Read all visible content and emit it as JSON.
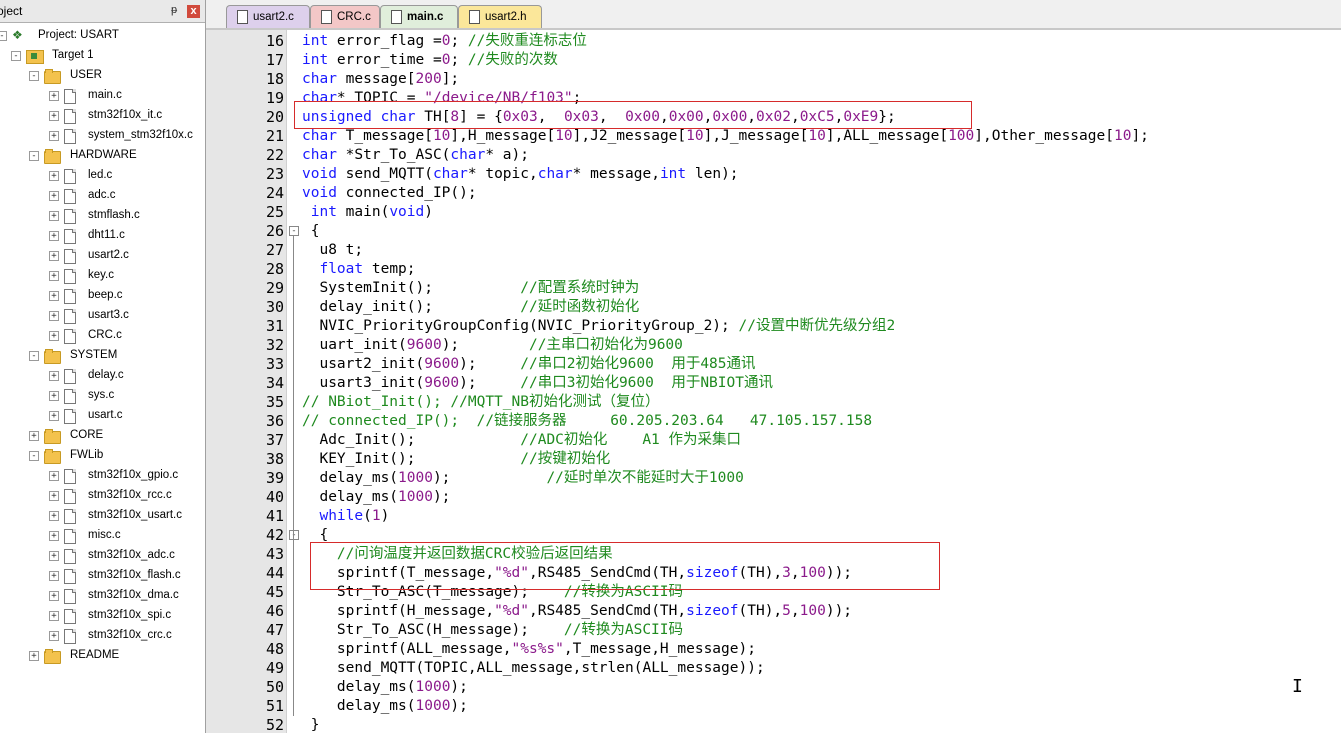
{
  "panel": {
    "title": "oject",
    "pin": "ᵽ",
    "close": "x"
  },
  "tree": [
    {
      "label": "Project: USART",
      "type": "project",
      "depth": 0,
      "expander": "-"
    },
    {
      "label": "Target 1",
      "type": "target",
      "depth": 1,
      "expander": "-"
    },
    {
      "label": "USER",
      "type": "folder",
      "depth": 2,
      "expander": "-"
    },
    {
      "label": "main.c",
      "type": "file",
      "depth": 3,
      "expander": "+"
    },
    {
      "label": "stm32f10x_it.c",
      "type": "file",
      "depth": 3,
      "expander": "+"
    },
    {
      "label": "system_stm32f10x.c",
      "type": "file",
      "depth": 3,
      "expander": "+"
    },
    {
      "label": "HARDWARE",
      "type": "folder",
      "depth": 2,
      "expander": "-"
    },
    {
      "label": "led.c",
      "type": "file",
      "depth": 3,
      "expander": "+"
    },
    {
      "label": "adc.c",
      "type": "file",
      "depth": 3,
      "expander": "+"
    },
    {
      "label": "stmflash.c",
      "type": "file",
      "depth": 3,
      "expander": "+"
    },
    {
      "label": "dht11.c",
      "type": "file",
      "depth": 3,
      "expander": "+"
    },
    {
      "label": "usart2.c",
      "type": "file",
      "depth": 3,
      "expander": "+"
    },
    {
      "label": "key.c",
      "type": "file",
      "depth": 3,
      "expander": "+"
    },
    {
      "label": "beep.c",
      "type": "file",
      "depth": 3,
      "expander": "+"
    },
    {
      "label": "usart3.c",
      "type": "file",
      "depth": 3,
      "expander": "+"
    },
    {
      "label": "CRC.c",
      "type": "file",
      "depth": 3,
      "expander": "+"
    },
    {
      "label": "SYSTEM",
      "type": "folder",
      "depth": 2,
      "expander": "-"
    },
    {
      "label": "delay.c",
      "type": "file",
      "depth": 3,
      "expander": "+"
    },
    {
      "label": "sys.c",
      "type": "file",
      "depth": 3,
      "expander": "+"
    },
    {
      "label": "usart.c",
      "type": "file",
      "depth": 3,
      "expander": "+"
    },
    {
      "label": "CORE",
      "type": "folder",
      "depth": 2,
      "expander": "+"
    },
    {
      "label": "FWLib",
      "type": "folder",
      "depth": 2,
      "expander": "-"
    },
    {
      "label": "stm32f10x_gpio.c",
      "type": "file",
      "depth": 3,
      "expander": "+"
    },
    {
      "label": "stm32f10x_rcc.c",
      "type": "file",
      "depth": 3,
      "expander": "+"
    },
    {
      "label": "stm32f10x_usart.c",
      "type": "file",
      "depth": 3,
      "expander": "+"
    },
    {
      "label": "misc.c",
      "type": "file",
      "depth": 3,
      "expander": "+"
    },
    {
      "label": "stm32f10x_adc.c",
      "type": "file",
      "depth": 3,
      "expander": "+"
    },
    {
      "label": "stm32f10x_flash.c",
      "type": "file",
      "depth": 3,
      "expander": "+"
    },
    {
      "label": "stm32f10x_dma.c",
      "type": "file",
      "depth": 3,
      "expander": "+"
    },
    {
      "label": "stm32f10x_spi.c",
      "type": "file",
      "depth": 3,
      "expander": "+"
    },
    {
      "label": "stm32f10x_crc.c",
      "type": "file",
      "depth": 3,
      "expander": "+"
    },
    {
      "label": "README",
      "type": "folder",
      "depth": 2,
      "expander": "+"
    }
  ],
  "tabs": [
    {
      "label": "usart2.c",
      "active": false
    },
    {
      "label": "CRC.c",
      "active": false
    },
    {
      "label": "main.c",
      "active": true
    },
    {
      "label": "usart2.h",
      "active": false
    }
  ],
  "colors": {
    "keyword": "#1a1aff",
    "number": "#8b1a8b",
    "comment": "#1f8a1f",
    "highlight_box": "#d62b2b"
  },
  "code": [
    {
      "n": 16,
      "t": [
        [
          "kw",
          "int"
        ],
        [
          "",
          " error_flag ="
        ],
        [
          "num",
          "0"
        ],
        [
          "",
          ";"
        ],
        [
          "cm",
          " //失败重连标志位"
        ]
      ]
    },
    {
      "n": 17,
      "t": [
        [
          "kw",
          "int"
        ],
        [
          "",
          " error_time ="
        ],
        [
          "num",
          "0"
        ],
        [
          "",
          ";"
        ],
        [
          "cm",
          " //失败的次数"
        ]
      ]
    },
    {
      "n": 18,
      "t": [
        [
          "kw",
          "char"
        ],
        [
          "",
          " message["
        ],
        [
          "num",
          "200"
        ],
        [
          "",
          "];"
        ]
      ]
    },
    {
      "n": 19,
      "t": [
        [
          "kw",
          "char"
        ],
        [
          "",
          "* TOPIC = "
        ],
        [
          "str",
          "\"/device/NB/f103\""
        ],
        [
          "",
          ";"
        ]
      ]
    },
    {
      "n": 20,
      "t": [
        [
          "kw",
          "unsigned char"
        ],
        [
          "",
          " TH["
        ],
        [
          "num",
          "8"
        ],
        [
          "",
          "] = {"
        ],
        [
          "num",
          "0x03"
        ],
        [
          "",
          ",  "
        ],
        [
          "num",
          "0x03"
        ],
        [
          "",
          ",  "
        ],
        [
          "num",
          "0x00"
        ],
        [
          "",
          ","
        ],
        [
          "num",
          "0x00"
        ],
        [
          "",
          ","
        ],
        [
          "num",
          "0x00"
        ],
        [
          "",
          ","
        ],
        [
          "num",
          "0x02"
        ],
        [
          "",
          ","
        ],
        [
          "num",
          "0xC5"
        ],
        [
          "",
          ","
        ],
        [
          "num",
          "0xE9"
        ],
        [
          "",
          "};"
        ]
      ]
    },
    {
      "n": 21,
      "t": [
        [
          "kw",
          "char"
        ],
        [
          "",
          " T_message["
        ],
        [
          "num",
          "10"
        ],
        [
          "",
          "],H_message["
        ],
        [
          "num",
          "10"
        ],
        [
          "",
          "],J2_message["
        ],
        [
          "num",
          "10"
        ],
        [
          "",
          "],J_message["
        ],
        [
          "num",
          "10"
        ],
        [
          "",
          "],ALL_message["
        ],
        [
          "num",
          "100"
        ],
        [
          "",
          "],Other_message["
        ],
        [
          "num",
          "10"
        ],
        [
          "",
          "];"
        ]
      ]
    },
    {
      "n": 22,
      "t": [
        [
          "kw",
          "char"
        ],
        [
          "",
          " *Str_To_ASC("
        ],
        [
          "kw",
          "char"
        ],
        [
          "",
          "* a);"
        ]
      ]
    },
    {
      "n": 23,
      "t": [
        [
          "kw",
          "void"
        ],
        [
          "",
          " send_MQTT("
        ],
        [
          "kw",
          "char"
        ],
        [
          "",
          "* topic,"
        ],
        [
          "kw",
          "char"
        ],
        [
          "",
          "* message,"
        ],
        [
          "kw",
          "int"
        ],
        [
          "",
          " len);"
        ]
      ]
    },
    {
      "n": 24,
      "t": [
        [
          "kw",
          "void"
        ],
        [
          "",
          " connected_IP();"
        ]
      ]
    },
    {
      "n": 25,
      "t": [
        [
          "",
          " "
        ],
        [
          "kw",
          "int"
        ],
        [
          "",
          " main("
        ],
        [
          "kw",
          "void"
        ],
        [
          "",
          ")"
        ]
      ]
    },
    {
      "n": 26,
      "t": [
        [
          "",
          " {"
        ]
      ],
      "fold": "-"
    },
    {
      "n": 27,
      "t": [
        [
          "",
          "  u8 t;"
        ]
      ]
    },
    {
      "n": 28,
      "t": [
        [
          "",
          "  "
        ],
        [
          "kw",
          "float"
        ],
        [
          "",
          " temp;"
        ]
      ]
    },
    {
      "n": 29,
      "t": [
        [
          "",
          "  SystemInit();          "
        ],
        [
          "cm",
          "//配置系统时钟为"
        ]
      ]
    },
    {
      "n": 30,
      "t": [
        [
          "",
          "  delay_init();          "
        ],
        [
          "cm",
          "//延时函数初始化"
        ]
      ]
    },
    {
      "n": 31,
      "t": [
        [
          "",
          "  NVIC_PriorityGroupConfig(NVIC_PriorityGroup_2); "
        ],
        [
          "cm",
          "//设置中断优先级分组2"
        ]
      ]
    },
    {
      "n": 32,
      "t": [
        [
          "",
          "  uart_init("
        ],
        [
          "num",
          "9600"
        ],
        [
          "",
          ");        "
        ],
        [
          "cm",
          "//主串口初始化为9600"
        ]
      ]
    },
    {
      "n": 33,
      "t": [
        [
          "",
          "  usart2_init("
        ],
        [
          "num",
          "9600"
        ],
        [
          "",
          ");     "
        ],
        [
          "cm",
          "//串口2初始化9600  用于485通讯"
        ]
      ]
    },
    {
      "n": 34,
      "t": [
        [
          "",
          "  usart3_init("
        ],
        [
          "num",
          "9600"
        ],
        [
          "",
          ");     "
        ],
        [
          "cm",
          "//串口3初始化9600  用于NBIOT通讯"
        ]
      ]
    },
    {
      "n": 35,
      "t": [
        [
          "cm",
          "// NBiot_Init(); //MQTT_NB初始化测试（复位）"
        ]
      ]
    },
    {
      "n": 36,
      "t": [
        [
          "cm",
          "// connected_IP();  //链接服务器     60.205.203.64   47.105.157.158"
        ]
      ]
    },
    {
      "n": 37,
      "t": [
        [
          "",
          "  Adc_Init();            "
        ],
        [
          "cm",
          "//ADC初始化    A1 作为采集口"
        ]
      ]
    },
    {
      "n": 38,
      "t": [
        [
          "",
          "  KEY_Init();            "
        ],
        [
          "cm",
          "//按键初始化"
        ]
      ]
    },
    {
      "n": 39,
      "t": [
        [
          "",
          "  delay_ms("
        ],
        [
          "num",
          "1000"
        ],
        [
          "",
          ");           "
        ],
        [
          "cm",
          "//延时单次不能延时大于1000"
        ]
      ]
    },
    {
      "n": 40,
      "t": [
        [
          "",
          "  delay_ms("
        ],
        [
          "num",
          "1000"
        ],
        [
          "",
          ");"
        ]
      ]
    },
    {
      "n": 41,
      "t": [
        [
          "",
          "  "
        ],
        [
          "kw",
          "while"
        ],
        [
          "",
          "("
        ],
        [
          "num",
          "1"
        ],
        [
          "",
          ")"
        ]
      ]
    },
    {
      "n": 42,
      "t": [
        [
          "",
          "  {"
        ]
      ],
      "fold": "-"
    },
    {
      "n": 43,
      "t": [
        [
          "",
          "    "
        ],
        [
          "cm",
          "//问询温度并返回数据CRC校验后返回结果"
        ]
      ]
    },
    {
      "n": 44,
      "t": [
        [
          "",
          "    sprintf(T_message,"
        ],
        [
          "str",
          "\"%d\""
        ],
        [
          "",
          ",RS485_SendCmd(TH,"
        ],
        [
          "kw",
          "sizeof"
        ],
        [
          "",
          "(TH),"
        ],
        [
          "num",
          "3"
        ],
        [
          "",
          ","
        ],
        [
          "num",
          "100"
        ],
        [
          "",
          "));"
        ]
      ]
    },
    {
      "n": 45,
      "t": [
        [
          "",
          "    Str_To_ASC(T_message);    "
        ],
        [
          "cm",
          "//转换为ASCII码"
        ]
      ]
    },
    {
      "n": 46,
      "t": [
        [
          "",
          "    sprintf(H_message,"
        ],
        [
          "str",
          "\"%d\""
        ],
        [
          "",
          ",RS485_SendCmd(TH,"
        ],
        [
          "kw",
          "sizeof"
        ],
        [
          "",
          "(TH),"
        ],
        [
          "num",
          "5"
        ],
        [
          "",
          ","
        ],
        [
          "num",
          "100"
        ],
        [
          "",
          "));"
        ]
      ]
    },
    {
      "n": 47,
      "t": [
        [
          "",
          "    Str_To_ASC(H_message);    "
        ],
        [
          "cm",
          "//转换为ASCII码"
        ]
      ]
    },
    {
      "n": 48,
      "t": [
        [
          "",
          "    sprintf(ALL_message,"
        ],
        [
          "str",
          "\"%s%s\""
        ],
        [
          "",
          ",T_message,H_message);"
        ]
      ]
    },
    {
      "n": 49,
      "t": [
        [
          "",
          "    send_MQTT(TOPIC,ALL_message,strlen(ALL_message));"
        ]
      ]
    },
    {
      "n": 50,
      "t": [
        [
          "",
          "    delay_ms("
        ],
        [
          "num",
          "1000"
        ],
        [
          "",
          ");"
        ]
      ]
    },
    {
      "n": 51,
      "t": [
        [
          "",
          "    delay_ms("
        ],
        [
          "num",
          "1000"
        ],
        [
          "",
          ");"
        ]
      ]
    },
    {
      "n": 52,
      "t": [
        [
          "",
          " }"
        ]
      ]
    }
  ],
  "cursor": "I"
}
